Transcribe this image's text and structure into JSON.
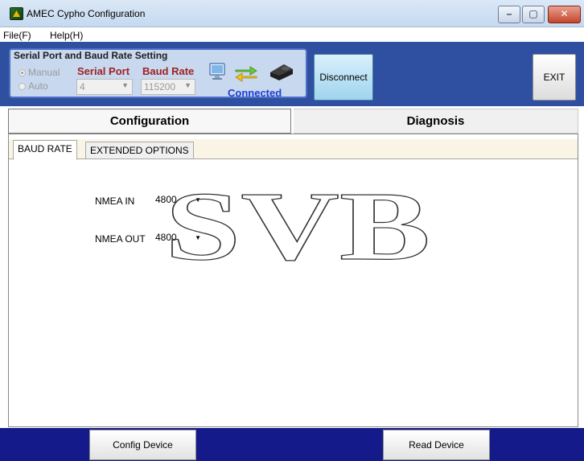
{
  "window": {
    "title": "AMEC Cypho Configuration",
    "controls": {
      "minimize": "–",
      "maximize": "▢",
      "close": "✕"
    }
  },
  "menu": {
    "file": "File(F)",
    "help": "Help(H)"
  },
  "serial": {
    "group_title": "Serial Port and Baud Rate Setting",
    "mode_manual": "Manual",
    "mode_auto": "Auto",
    "selected_mode": "Manual",
    "serial_port_label": "Serial Port",
    "baud_rate_label": "Baud Rate",
    "serial_port_value": "4",
    "baud_rate_value": "115200",
    "status": "Connected",
    "icons": [
      "monitor-icon",
      "transfer-arrows-icon",
      "device-icon"
    ]
  },
  "buttons": {
    "disconnect": "Disconnect",
    "exit": "EXIT"
  },
  "main_tabs": {
    "configuration": "Configuration",
    "diagnosis": "Diagnosis",
    "active": "Configuration"
  },
  "sub_tabs": {
    "baud_rate": "BAUD RATE",
    "extended_options": "EXTENDED OPTIONS",
    "active": "BAUD RATE"
  },
  "baud_settings": {
    "nmea_in_label": "NMEA IN",
    "nmea_in_value": "4800",
    "nmea_out_label": "NMEA OUT",
    "nmea_out_value": "4800"
  },
  "watermark": "SVB",
  "footer": {
    "config_device": "Config Device",
    "read_device": "Read Device"
  },
  "colors": {
    "header_bg": "#2f4fa0",
    "footer_bg": "#141a8a",
    "label_red": "#a02222",
    "connected_blue": "#1e3ed4"
  }
}
